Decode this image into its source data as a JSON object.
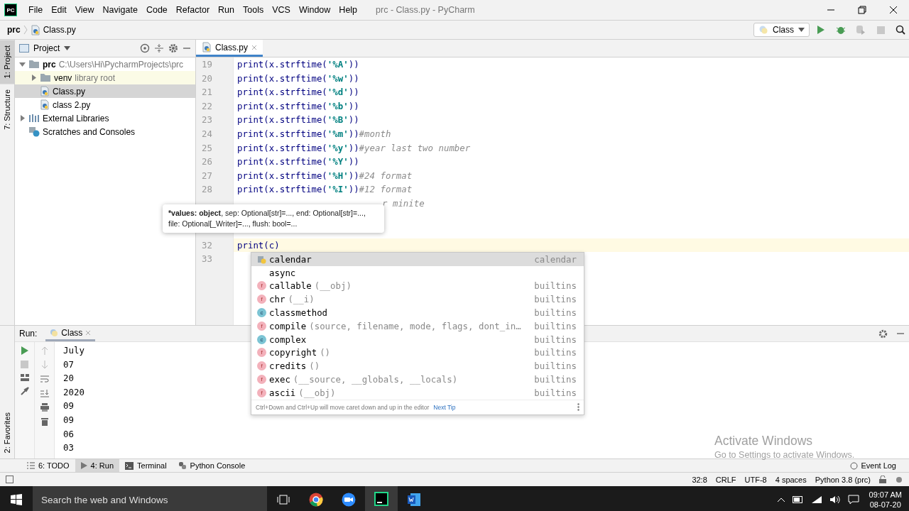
{
  "menu_bar": {
    "logo": "PC",
    "items": [
      "File",
      "Edit",
      "View",
      "Navigate",
      "Code",
      "Refactor",
      "Run",
      "Tools",
      "VCS",
      "Window",
      "Help"
    ],
    "title": "prc - Class.py - PyCharm"
  },
  "nav_bar": {
    "breadcrumbs": [
      "prc",
      "Class.py"
    ],
    "run_config": "Class"
  },
  "side_stripe": {
    "top": [
      {
        "label": "1: Project",
        "selected": true
      },
      {
        "label": "7: Structure",
        "selected": false
      }
    ],
    "bottom": [
      {
        "label": "2: Favorites",
        "selected": false
      }
    ]
  },
  "project_panel": {
    "title": "Project",
    "tree": [
      {
        "kind": "folder",
        "name": "prc",
        "hint": "C:\\Users\\Hi\\PycharmProjects\\prc",
        "expanded": true,
        "selected": false,
        "children": [
          {
            "kind": "folder",
            "name": "venv",
            "hint": "library root",
            "expanded": false,
            "selected": false,
            "library": true
          },
          {
            "kind": "file",
            "name": "Class.py",
            "selected": true
          },
          {
            "kind": "file",
            "name": "class 2.py",
            "selected": false
          }
        ]
      },
      {
        "kind": "libraries",
        "name": "External Libraries",
        "expanded": false,
        "selected": false
      },
      {
        "kind": "scratches",
        "name": "Scratches and Consoles",
        "selected": false
      }
    ]
  },
  "editor": {
    "tabs": [
      {
        "label": "Class.py",
        "selected": true
      }
    ],
    "lines": [
      {
        "number": "19",
        "code": "print(x.strftime('%A'))"
      },
      {
        "number": "20",
        "code": "print(x.strftime('%w'))"
      },
      {
        "number": "21",
        "code": "print(x.strftime('%d'))"
      },
      {
        "number": "22",
        "code": "print(x.strftime('%b'))"
      },
      {
        "number": "23",
        "code": "print(x.strftime('%B'))"
      },
      {
        "number": "24",
        "code": "print(x.strftime('%m'))",
        "comment": "#month"
      },
      {
        "number": "25",
        "code": "print(x.strftime('%y'))",
        "comment": "#year last two number"
      },
      {
        "number": "26",
        "code": "print(x.strftime('%Y'))"
      },
      {
        "number": "27",
        "code": "print(x.strftime('%H'))",
        "comment": "#24 format"
      },
      {
        "number": "28",
        "code": "print(x.strftime('%I'))",
        "comment": "#12 format"
      },
      {
        "hidden_comment": "r minite"
      },
      {
        "number": "32",
        "code": "print(c)",
        "current": true
      },
      {
        "number": "33"
      }
    ],
    "param_hint": {
      "bold": "*values: object",
      "rest": ", sep: Optional[str]=..., end: Optional[str]=..., file: Optional[_Writer]=..., flush: bool=..."
    },
    "completion": {
      "items": [
        {
          "kind": "module",
          "name": "calendar",
          "source": "calendar",
          "selected": true
        },
        {
          "kind": "keyword",
          "name": "async",
          "selected": false
        },
        {
          "kind": "function",
          "badge": "f",
          "name": "callable",
          "args": "(__obj)",
          "source": "builtins",
          "selected": false
        },
        {
          "kind": "function",
          "badge": "f",
          "name": "chr",
          "args": "(__i)",
          "source": "builtins",
          "selected": false
        },
        {
          "kind": "class",
          "badge": "c",
          "name": "classmethod",
          "source": "builtins",
          "selected": false
        },
        {
          "kind": "function",
          "badge": "f",
          "name": "compile",
          "args": "(source, filename, mode, flags, dont_in…",
          "source": "builtins",
          "selected": false
        },
        {
          "kind": "class",
          "badge": "c",
          "name": "complex",
          "source": "builtins",
          "selected": false
        },
        {
          "kind": "function",
          "badge": "f",
          "name": "copyright",
          "args": "()",
          "source": "builtins",
          "selected": false
        },
        {
          "kind": "function",
          "badge": "f",
          "name": "credits",
          "args": "()",
          "source": "builtins",
          "selected": false
        },
        {
          "kind": "function",
          "badge": "f",
          "name": "exec",
          "args": "(__source, __globals, __locals)",
          "source": "builtins",
          "selected": false
        },
        {
          "kind": "function",
          "badge": "f",
          "name": "ascii",
          "args": "(__obj)",
          "source": "builtins",
          "selected": false
        }
      ],
      "tip": "Ctrl+Down and Ctrl+Up will move caret down and up in the editor",
      "tip_link": "Next Tip"
    }
  },
  "run_panel": {
    "label": "Run:",
    "tab": "Class",
    "output": [
      "July",
      "07",
      "20",
      "2020",
      "09",
      "09",
      "06",
      "03"
    ]
  },
  "tool_tabs": [
    {
      "label": "6: TODO",
      "kind": "list",
      "selected": false
    },
    {
      "label": "4: Run",
      "kind": "run",
      "selected": true
    },
    {
      "label": "Terminal",
      "kind": "terminal",
      "selected": false
    },
    {
      "label": "Python Console",
      "kind": "python",
      "selected": false
    }
  ],
  "event_log": "Event Log",
  "activation": {
    "title": "Activate Windows",
    "subtitle": "Go to Settings to activate Windows."
  },
  "status_bar": [
    "32:8",
    "CRLF",
    "UTF-8",
    "4 spaces",
    "Python 3.8 (prc)"
  ],
  "taskbar": {
    "search": "Search the web and Windows",
    "time": "09:07 AM",
    "date": "08-07-20"
  }
}
